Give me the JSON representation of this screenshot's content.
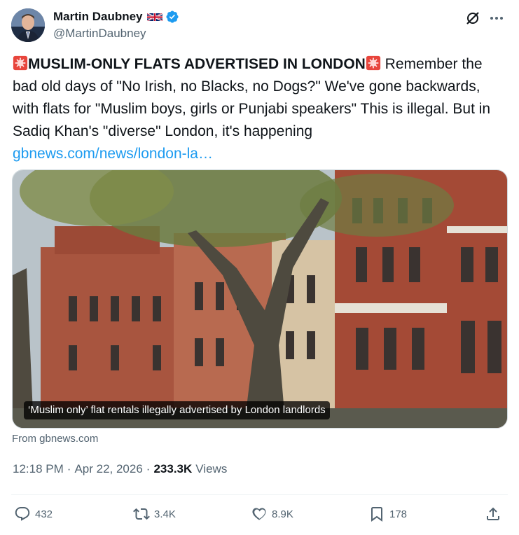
{
  "author": {
    "display_name": "Martin Daubney",
    "handle": "@MartinDaubney",
    "flag_icon": "uk-flag-icon",
    "verified_icon": "verified-badge-icon"
  },
  "tweet": {
    "headline": "MUSLIM-ONLY FLATS ADVERTISED IN LONDON",
    "body": " Remember the bad old days of \"No Irish, no Blacks, no Dogs?\" We've gone backwards, with flats for \"Muslim boys, girls or Punjabi speakers\" This is illegal. But in Sadiq Khan's \"diverse\" London, it's happening",
    "link": "gbnews.com/news/london-la…"
  },
  "media": {
    "caption": "‘Muslim only’ flat rentals illegally advertised by London landlords",
    "source": "From gbnews.com"
  },
  "meta": {
    "time": "12:18 PM",
    "separator1": "·",
    "date": "Apr 22, 2026",
    "separator2": "·",
    "views_count": "233.3K",
    "views_label": "Views"
  },
  "actions": {
    "replies": "432",
    "reposts": "3.4K",
    "likes": "8.9K",
    "bookmarks": "178"
  },
  "colors": {
    "accent": "#1d9bf0",
    "text_primary": "#0f1419",
    "text_secondary": "#536471",
    "border": "#cfd9de"
  }
}
